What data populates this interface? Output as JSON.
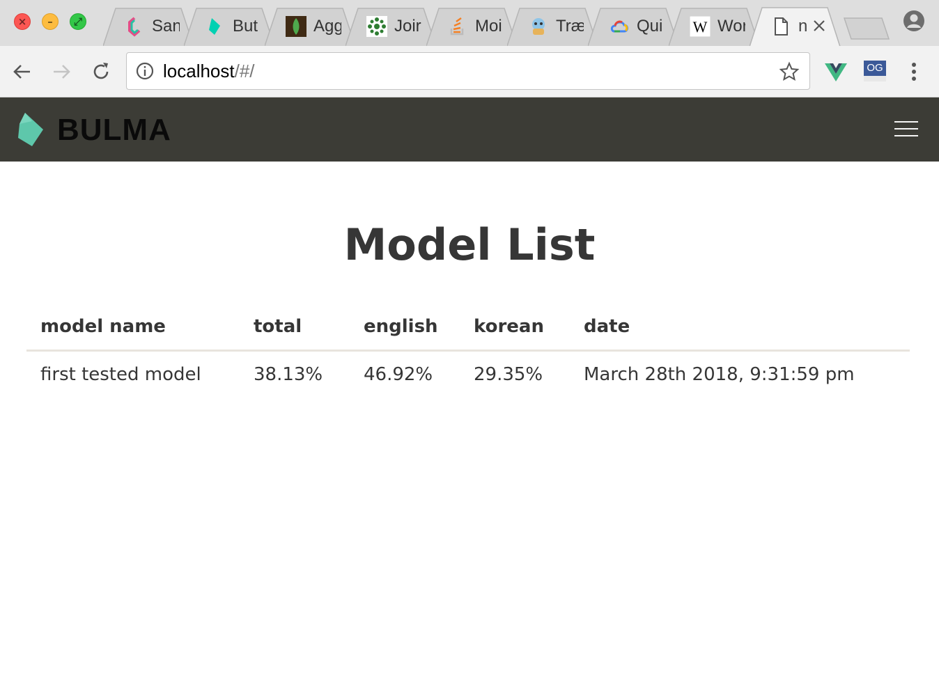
{
  "browser": {
    "tabs": [
      {
        "title": "San",
        "favicon": "sandbox-icon"
      },
      {
        "title": "But",
        "favicon": "bulma-icon"
      },
      {
        "title": "Agg",
        "favicon": "mongodb-icon"
      },
      {
        "title": "Joir",
        "favicon": "network-graph-icon"
      },
      {
        "title": "Moi",
        "favicon": "stack-overflow-icon"
      },
      {
        "title": "Træ",
        "favicon": "traefik-icon"
      },
      {
        "title": "Qui",
        "favicon": "google-cloud-icon"
      },
      {
        "title": "Wor",
        "favicon": "wikipedia-icon"
      },
      {
        "title": "n",
        "favicon": "document-icon",
        "active": true
      }
    ],
    "url": {
      "host": "localhost",
      "path": "/#/"
    },
    "extensions": [
      {
        "name": "vue-devtools-icon",
        "color": "#41b883"
      },
      {
        "label": "OG",
        "name": "og-extension-icon",
        "color": "#3b5998"
      }
    ]
  },
  "navbar": {
    "brand": "BULMA",
    "brand_color": "#00d1b2",
    "background": "#3c3c36"
  },
  "page": {
    "title": "Model List"
  },
  "table": {
    "columns": [
      "model name",
      "total",
      "english",
      "korean",
      "date"
    ],
    "rows": [
      [
        "first tested model",
        "38.13%",
        "46.92%",
        "29.35%",
        "March 28th 2018, 9:31:59 pm"
      ]
    ]
  }
}
